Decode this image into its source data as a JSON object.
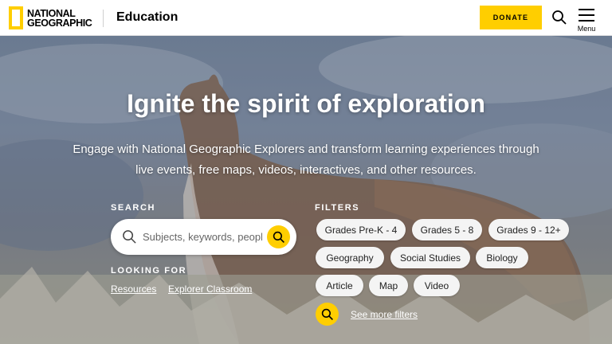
{
  "header": {
    "logo_line1": "NATIONAL",
    "logo_line2": "GEOGRAPHIC",
    "section": "Education",
    "donate_label": "DONATE",
    "menu_label": "Menu",
    "brand_color": "#ffce00"
  },
  "hero": {
    "title": "Ignite the spirit of exploration",
    "subtitle": "Engage with National Geographic Explorers and transform learning experiences through live events, free maps, videos, interactives, and other resources."
  },
  "search": {
    "label": "SEARCH",
    "placeholder": "Subjects, keywords, people",
    "value": ""
  },
  "looking_for": {
    "label": "LOOKING FOR",
    "links": [
      "Resources",
      "Explorer Classroom"
    ]
  },
  "filters": {
    "label": "FILTERS",
    "chips": [
      "Grades Pre-K - 4",
      "Grades 5 - 8",
      "Grades 9 - 12+",
      "Geography",
      "Social Studies",
      "Biology",
      "Article",
      "Map",
      "Video"
    ],
    "more_label": "See more filters"
  }
}
